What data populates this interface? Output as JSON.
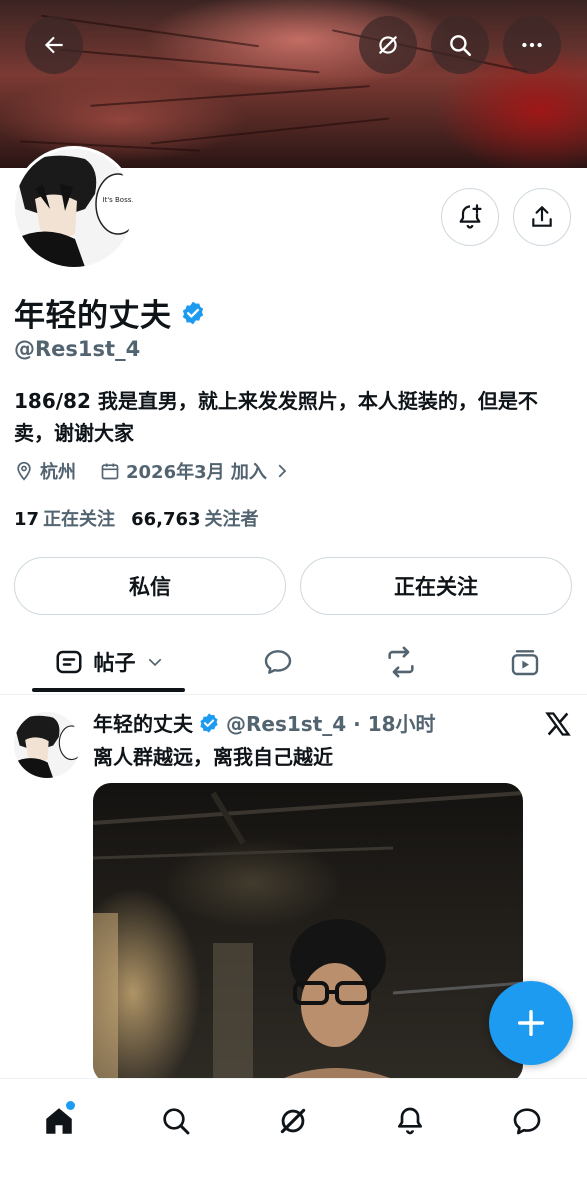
{
  "profile": {
    "display_name": "年轻的丈夫",
    "handle": "@Res1st_4",
    "bio": "186/82 我是直男，就上来发发照片，本人挺装的，但是不卖，谢谢大家",
    "location": "杭州",
    "joined": "2026年3月 加入",
    "following_count": "17",
    "following_label": "正在关注",
    "followers_count": "66,763",
    "followers_label": "关注者",
    "verified": true
  },
  "avatar": {
    "speech_text": "It's Boss."
  },
  "actions": {
    "message_label": "私信",
    "following_button_label": "正在关注"
  },
  "tabs": {
    "posts_label": "帖子"
  },
  "tweet": {
    "author": "年轻的丈夫",
    "meta": "@Res1st_4 · 18小时",
    "text": "离人群越远，离我自己越近"
  },
  "icons": {
    "back": "arrow-left-icon",
    "grok": "grok-icon",
    "search": "search-icon",
    "more": "more-icon",
    "notify": "bell-plus-icon",
    "share": "share-icon",
    "verified": "verified-badge-icon",
    "location": "location-pin-icon",
    "calendar": "calendar-icon",
    "chevron": "chevron-right-icon",
    "posts_tab": "posts-icon",
    "replies_tab": "chat-bubble-icon",
    "reposts_tab": "repost-icon",
    "media_tab": "video-icon",
    "x_logo": "x-logo-icon",
    "compose": "plus-icon",
    "nav_home": "home-icon",
    "nav_search": "search-icon",
    "nav_grok": "grok-icon",
    "nav_notifications": "bell-icon",
    "nav_messages": "chat-icon"
  },
  "colors": {
    "accent": "#1d9bf0",
    "text": "#0f1419",
    "secondary": "#536471",
    "border": "#cfd9de"
  }
}
